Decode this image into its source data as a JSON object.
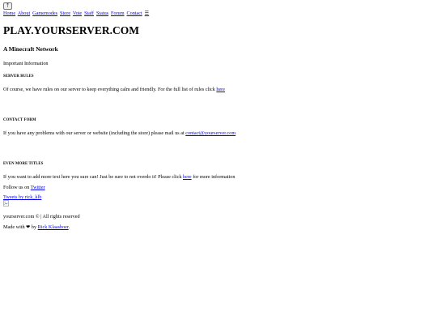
{
  "top_button": {
    "icon": "arrow-up-icon",
    "glyph": "🡑"
  },
  "nav": {
    "items": [
      {
        "label": "Home"
      },
      {
        "label": "About"
      },
      {
        "label": "Gamemodes"
      },
      {
        "label": "Store"
      },
      {
        "label": "Vote"
      },
      {
        "label": "Staff"
      },
      {
        "label": "Status"
      },
      {
        "label": "Forum"
      },
      {
        "label": "Contact"
      }
    ],
    "menu_glyph": "☰"
  },
  "site": {
    "title": "PLAY.YOURSERVER.COM",
    "subtitle": "A Minecraft Network",
    "important": "Important Information"
  },
  "sections": [
    {
      "title": "SERVER RULES",
      "text": "Of course, we have rules on our server to keep everything calm and friendly. For the full list of rules click ",
      "link": "here",
      "text_after": ""
    },
    {
      "title": "CONTACT FORM",
      "text": "If you have any problems with our server or website (including the store) please mail us at ",
      "link": "contact@yourserver.com",
      "text_after": ""
    },
    {
      "title": "EVEN MORE TITLES",
      "text": "If you want to add more text here you sure can! Just be sure to not overdo it! Please click ",
      "link": "here",
      "text_after": " for more information"
    }
  ],
  "social": {
    "follow_text": "Follow us on ",
    "follow_link": "Twitter",
    "tweets_link": "Tweets by rick_klb"
  },
  "footer": {
    "copyright": "yourserver.com © | All rights reserved",
    "made_with": "Made with ❤ by ",
    "author_link": "Rick Klaasboer",
    "author_suffix": "."
  }
}
